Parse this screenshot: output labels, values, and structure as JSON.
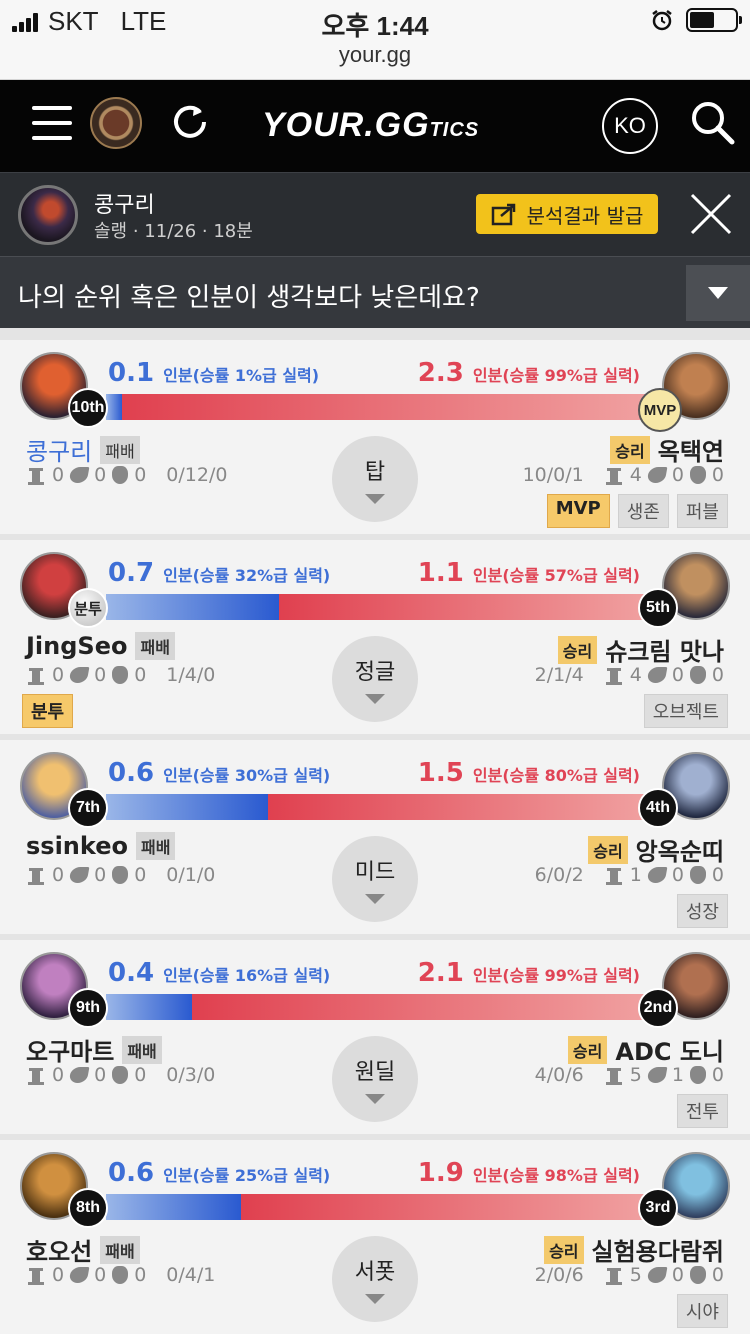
{
  "status_bar": {
    "carrier": "SKT",
    "network": "LTE",
    "time": "오후 1:44",
    "url": "your.gg"
  },
  "nav": {
    "logo": "YOUR.GG",
    "logo_suffix": "TICS",
    "lang": "KO",
    "icons": [
      "menu-icon",
      "tier-emblem-icon",
      "refresh-icon",
      "search-icon"
    ]
  },
  "profile": {
    "name": "콩구리",
    "meta": "솔랭 · 11/26 · 18분",
    "share_label": "분석결과 발급"
  },
  "question": {
    "text": "나의 순위 혹은 인분이 생각보다 낮은데요?"
  },
  "colors": {
    "blue": "#3e6fd6",
    "red": "#e04455",
    "badge_yellow": "#f3c96b",
    "nav_bg": "#050505"
  },
  "matchups": [
    {
      "position": "탑",
      "left": {
        "name": "콩구리",
        "result": "패배",
        "rank": "10th",
        "score": "0.1",
        "suffix": "인분(승률 1%급 실력)",
        "towers": "0",
        "dragons": "0",
        "barons": "0",
        "kda": "0/12/0",
        "badges": [],
        "highlight": true,
        "avatar": [
          "#e06030",
          "#2a2030"
        ]
      },
      "right": {
        "name": "옥택연",
        "result": "승리",
        "rank": "MVP",
        "score": "2.3",
        "suffix": "인분(승률 99%급 실력)",
        "towers": "4",
        "dragons": "0",
        "barons": "0",
        "kda": "10/0/1",
        "badges": [
          "MVP",
          "생존",
          "퍼블"
        ],
        "avatar": [
          "#c08050",
          "#4a3020"
        ]
      },
      "win_prob": 0.01
    },
    {
      "position": "정글",
      "left": {
        "name": "JingSeo",
        "result": "패배",
        "rank": "분투",
        "score": "0.7",
        "suffix": "인분(승률 32%급 실력)",
        "towers": "0",
        "dragons": "0",
        "barons": "0",
        "kda": "1/4/0",
        "badges": [
          "분투"
        ],
        "avatar": [
          "#d04040",
          "#3a2020"
        ]
      },
      "right": {
        "name": "슈크림 맛나",
        "result": "승리",
        "rank": "5th",
        "score": "1.1",
        "suffix": "인분(승률 57%급 실력)",
        "towers": "4",
        "dragons": "0",
        "barons": "0",
        "kda": "2/1/4",
        "badges": [
          "오브젝트"
        ],
        "avatar": [
          "#c09060",
          "#2a2a3a"
        ]
      },
      "win_prob": 0.32
    },
    {
      "position": "미드",
      "left": {
        "name": "ssinkeo",
        "result": "패배",
        "rank": "7th",
        "score": "0.6",
        "suffix": "인분(승률 30%급 실력)",
        "towers": "0",
        "dragons": "0",
        "barons": "0",
        "kda": "0/1/0",
        "badges": [],
        "avatar": [
          "#f0c070",
          "#5060a0"
        ]
      },
      "right": {
        "name": "앙옥순띠",
        "result": "승리",
        "rank": "4th",
        "score": "1.5",
        "suffix": "인분(승률 80%급 실력)",
        "towers": "1",
        "dragons": "0",
        "barons": "0",
        "kda": "6/0/2",
        "badges": [
          "성장"
        ],
        "avatar": [
          "#a0b0d0",
          "#202840"
        ]
      },
      "win_prob": 0.3
    },
    {
      "position": "원딜",
      "left": {
        "name": "오구마트",
        "result": "패배",
        "rank": "9th",
        "score": "0.4",
        "suffix": "인분(승률 16%급 실력)",
        "towers": "0",
        "dragons": "0",
        "barons": "0",
        "kda": "0/3/0",
        "badges": [],
        "avatar": [
          "#c080c0",
          "#302040"
        ]
      },
      "right": {
        "name": "ADC 도니",
        "result": "승리",
        "rank": "2nd",
        "score": "2.1",
        "suffix": "인분(승률 99%급 실력)",
        "towers": "5",
        "dragons": "1",
        "barons": "0",
        "kda": "4/0/6",
        "badges": [
          "전투"
        ],
        "avatar": [
          "#b07050",
          "#302020"
        ]
      },
      "win_prob": 0.16
    },
    {
      "position": "서폿",
      "left": {
        "name": "호오선",
        "result": "패배",
        "rank": "8th",
        "score": "0.6",
        "suffix": "인분(승률 25%급 실력)",
        "towers": "0",
        "dragons": "0",
        "barons": "0",
        "kda": "0/4/1",
        "badges": [],
        "avatar": [
          "#d09040",
          "#4a3010"
        ]
      },
      "right": {
        "name": "실험용다람쥐",
        "result": "승리",
        "rank": "3rd",
        "score": "1.9",
        "suffix": "인분(승률 98%급 실력)",
        "towers": "5",
        "dragons": "0",
        "barons": "0",
        "kda": "2/0/6",
        "badges": [
          "시야"
        ],
        "avatar": [
          "#80c0e0",
          "#304060"
        ]
      },
      "win_prob": 0.25
    }
  ]
}
